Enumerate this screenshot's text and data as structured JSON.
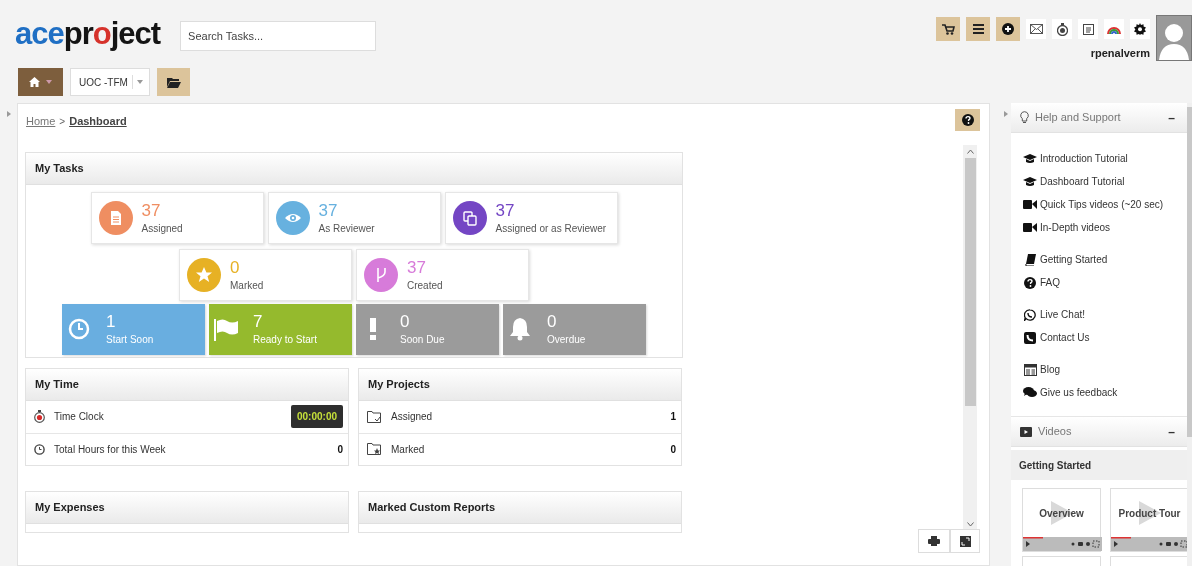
{
  "logo": {
    "parts": [
      {
        "text": "ace",
        "color": "#1f6fc4"
      },
      {
        "text": "pr",
        "color": "#141414"
      },
      {
        "text": "o",
        "color": "#d6322b"
      },
      {
        "text": "ject",
        "color": "#141414"
      }
    ]
  },
  "search": {
    "placeholder": "Search Tasks..."
  },
  "toolbar": {
    "buttons": [
      {
        "kind": "cart"
      },
      {
        "kind": "menu"
      },
      {
        "kind": "add"
      }
    ],
    "icons": [
      {
        "kind": "mail"
      },
      {
        "kind": "timer"
      },
      {
        "kind": "calendar"
      },
      {
        "kind": "rainbow"
      },
      {
        "kind": "gear"
      }
    ]
  },
  "user": {
    "name": "rpenalverm"
  },
  "project_selector": {
    "value": "UOC -TFM"
  },
  "breadcrumb": {
    "separator": ">",
    "items": [
      {
        "label": "Home",
        "current": false
      },
      {
        "label": "Dashboard",
        "current": true
      }
    ]
  },
  "my_tasks": {
    "title": "My Tasks",
    "rows": [
      [
        {
          "kind": "assigned",
          "count": "37",
          "label": "Assigned",
          "color": "#ef8e62"
        },
        {
          "kind": "reviewer",
          "count": "37",
          "label": "As Reviewer",
          "color": "#67b1df"
        },
        {
          "kind": "either",
          "count": "37",
          "label": "Assigned or as Reviewer",
          "color": "#7446c4"
        }
      ],
      [
        {
          "kind": "marked",
          "count": "0",
          "label": "Marked",
          "color": "#e6b125"
        },
        {
          "kind": "created",
          "count": "37",
          "label": "Created",
          "color": "#d77bd9"
        }
      ]
    ],
    "status_tiles": [
      {
        "kind": "soon",
        "count": "1",
        "label": "Start Soon",
        "color": "#69aee0"
      },
      {
        "kind": "ready",
        "count": "7",
        "label": "Ready to Start",
        "color": "#95ba2d"
      },
      {
        "kind": "due",
        "count": "0",
        "label": "Soon Due",
        "color": "#9b9b9b"
      },
      {
        "kind": "overdue",
        "count": "0",
        "label": "Overdue",
        "color": "#9b9b9b"
      }
    ]
  },
  "my_time": {
    "title": "My Time",
    "rows": [
      {
        "kind": "timeclock",
        "label": "Time Clock",
        "value": "00:00:00"
      },
      {
        "kind": "hours",
        "label": "Total Hours for this Week",
        "value": "0"
      }
    ]
  },
  "my_projects": {
    "title": "My Projects",
    "rows": [
      {
        "kind": "assigned",
        "label": "Assigned",
        "value": "1"
      },
      {
        "kind": "marked",
        "label": "Marked",
        "value": "0"
      }
    ]
  },
  "my_expenses": {
    "title": "My Expenses"
  },
  "marked_custom_reports": {
    "title": "Marked Custom Reports"
  },
  "help": {
    "title": "Help and Support",
    "collapse": "–",
    "groups": [
      [
        {
          "kind": "cap",
          "label": "Introduction Tutorial"
        },
        {
          "kind": "cap",
          "label": "Dashboard Tutorial"
        },
        {
          "kind": "video",
          "label": "Quick Tips videos (~20 sec)"
        },
        {
          "kind": "video",
          "label": "In-Depth videos"
        }
      ],
      [
        {
          "kind": "book",
          "label": "Getting Started"
        },
        {
          "kind": "question",
          "label": "FAQ"
        }
      ],
      [
        {
          "kind": "chat",
          "label": "Live Chat!"
        },
        {
          "kind": "phone",
          "label": "Contact Us"
        }
      ],
      [
        {
          "kind": "blog",
          "label": "Blog"
        },
        {
          "kind": "comments",
          "label": "Give us feedback"
        }
      ]
    ]
  },
  "videos": {
    "title": "Videos",
    "collapse": "–",
    "section": "Getting Started",
    "items": [
      {
        "title": "Overview"
      },
      {
        "title": "Product Tour"
      }
    ]
  }
}
